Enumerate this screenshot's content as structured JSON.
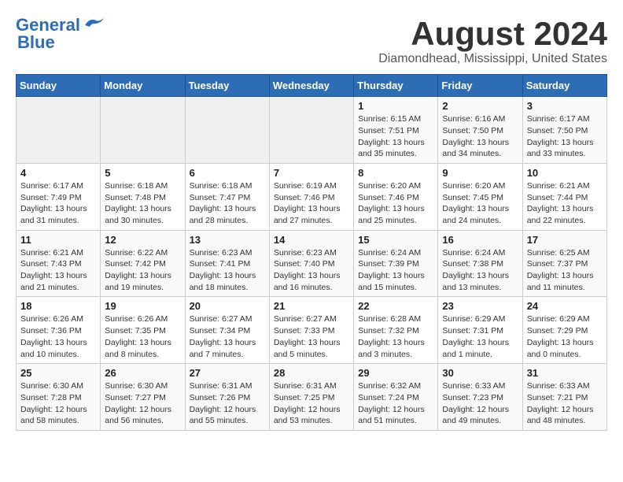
{
  "header": {
    "logo_line1": "General",
    "logo_line2": "Blue",
    "month": "August 2024",
    "location": "Diamondhead, Mississippi, United States"
  },
  "weekdays": [
    "Sunday",
    "Monday",
    "Tuesday",
    "Wednesday",
    "Thursday",
    "Friday",
    "Saturday"
  ],
  "weeks": [
    [
      {
        "day": "",
        "info": ""
      },
      {
        "day": "",
        "info": ""
      },
      {
        "day": "",
        "info": ""
      },
      {
        "day": "",
        "info": ""
      },
      {
        "day": "1",
        "info": "Sunrise: 6:15 AM\nSunset: 7:51 PM\nDaylight: 13 hours\nand 35 minutes."
      },
      {
        "day": "2",
        "info": "Sunrise: 6:16 AM\nSunset: 7:50 PM\nDaylight: 13 hours\nand 34 minutes."
      },
      {
        "day": "3",
        "info": "Sunrise: 6:17 AM\nSunset: 7:50 PM\nDaylight: 13 hours\nand 33 minutes."
      }
    ],
    [
      {
        "day": "4",
        "info": "Sunrise: 6:17 AM\nSunset: 7:49 PM\nDaylight: 13 hours\nand 31 minutes."
      },
      {
        "day": "5",
        "info": "Sunrise: 6:18 AM\nSunset: 7:48 PM\nDaylight: 13 hours\nand 30 minutes."
      },
      {
        "day": "6",
        "info": "Sunrise: 6:18 AM\nSunset: 7:47 PM\nDaylight: 13 hours\nand 28 minutes."
      },
      {
        "day": "7",
        "info": "Sunrise: 6:19 AM\nSunset: 7:46 PM\nDaylight: 13 hours\nand 27 minutes."
      },
      {
        "day": "8",
        "info": "Sunrise: 6:20 AM\nSunset: 7:46 PM\nDaylight: 13 hours\nand 25 minutes."
      },
      {
        "day": "9",
        "info": "Sunrise: 6:20 AM\nSunset: 7:45 PM\nDaylight: 13 hours\nand 24 minutes."
      },
      {
        "day": "10",
        "info": "Sunrise: 6:21 AM\nSunset: 7:44 PM\nDaylight: 13 hours\nand 22 minutes."
      }
    ],
    [
      {
        "day": "11",
        "info": "Sunrise: 6:21 AM\nSunset: 7:43 PM\nDaylight: 13 hours\nand 21 minutes."
      },
      {
        "day": "12",
        "info": "Sunrise: 6:22 AM\nSunset: 7:42 PM\nDaylight: 13 hours\nand 19 minutes."
      },
      {
        "day": "13",
        "info": "Sunrise: 6:23 AM\nSunset: 7:41 PM\nDaylight: 13 hours\nand 18 minutes."
      },
      {
        "day": "14",
        "info": "Sunrise: 6:23 AM\nSunset: 7:40 PM\nDaylight: 13 hours\nand 16 minutes."
      },
      {
        "day": "15",
        "info": "Sunrise: 6:24 AM\nSunset: 7:39 PM\nDaylight: 13 hours\nand 15 minutes."
      },
      {
        "day": "16",
        "info": "Sunrise: 6:24 AM\nSunset: 7:38 PM\nDaylight: 13 hours\nand 13 minutes."
      },
      {
        "day": "17",
        "info": "Sunrise: 6:25 AM\nSunset: 7:37 PM\nDaylight: 13 hours\nand 11 minutes."
      }
    ],
    [
      {
        "day": "18",
        "info": "Sunrise: 6:26 AM\nSunset: 7:36 PM\nDaylight: 13 hours\nand 10 minutes."
      },
      {
        "day": "19",
        "info": "Sunrise: 6:26 AM\nSunset: 7:35 PM\nDaylight: 13 hours\nand 8 minutes."
      },
      {
        "day": "20",
        "info": "Sunrise: 6:27 AM\nSunset: 7:34 PM\nDaylight: 13 hours\nand 7 minutes."
      },
      {
        "day": "21",
        "info": "Sunrise: 6:27 AM\nSunset: 7:33 PM\nDaylight: 13 hours\nand 5 minutes."
      },
      {
        "day": "22",
        "info": "Sunrise: 6:28 AM\nSunset: 7:32 PM\nDaylight: 13 hours\nand 3 minutes."
      },
      {
        "day": "23",
        "info": "Sunrise: 6:29 AM\nSunset: 7:31 PM\nDaylight: 13 hours\nand 1 minute."
      },
      {
        "day": "24",
        "info": "Sunrise: 6:29 AM\nSunset: 7:29 PM\nDaylight: 13 hours\nand 0 minutes."
      }
    ],
    [
      {
        "day": "25",
        "info": "Sunrise: 6:30 AM\nSunset: 7:28 PM\nDaylight: 12 hours\nand 58 minutes."
      },
      {
        "day": "26",
        "info": "Sunrise: 6:30 AM\nSunset: 7:27 PM\nDaylight: 12 hours\nand 56 minutes."
      },
      {
        "day": "27",
        "info": "Sunrise: 6:31 AM\nSunset: 7:26 PM\nDaylight: 12 hours\nand 55 minutes."
      },
      {
        "day": "28",
        "info": "Sunrise: 6:31 AM\nSunset: 7:25 PM\nDaylight: 12 hours\nand 53 minutes."
      },
      {
        "day": "29",
        "info": "Sunrise: 6:32 AM\nSunset: 7:24 PM\nDaylight: 12 hours\nand 51 minutes."
      },
      {
        "day": "30",
        "info": "Sunrise: 6:33 AM\nSunset: 7:23 PM\nDaylight: 12 hours\nand 49 minutes."
      },
      {
        "day": "31",
        "info": "Sunrise: 6:33 AM\nSunset: 7:21 PM\nDaylight: 12 hours\nand 48 minutes."
      }
    ]
  ]
}
